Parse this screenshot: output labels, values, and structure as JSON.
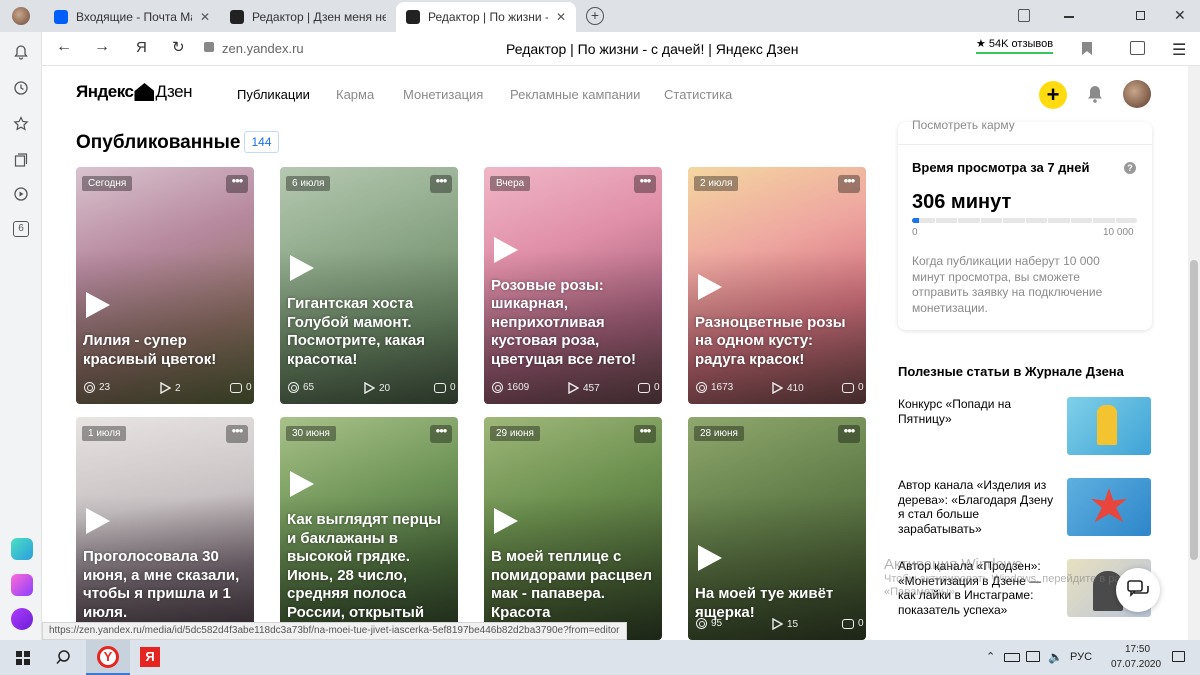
{
  "browser": {
    "tabs": [
      {
        "title": "Входящие - Почта Mail.ru",
        "fav_color": "#005ff9",
        "active": false
      },
      {
        "title": "Редактор | Дзен меня не л",
        "fav_color": "#222222",
        "active": false
      },
      {
        "title": "Редактор | По жизни - с",
        "fav_color": "#222222",
        "active": true
      }
    ],
    "new_tab": "+",
    "address": "zen.yandex.ru",
    "page_title": "Редактор | По жизни - с дачей! | Яндекс Дзен",
    "reviews": "★ 54K отзывов",
    "yandex_letter": "Я",
    "sidebar_badge": "6"
  },
  "header": {
    "logo_text": "Яндекс",
    "logo_text2": "Дзен",
    "nav": [
      "Публикации",
      "Карма",
      "Монетизация",
      "Рекламные кампании",
      "Статистика"
    ],
    "plus": "+"
  },
  "section": {
    "title": "Опубликованные",
    "count": "144"
  },
  "cards": [
    {
      "date": "Сегодня",
      "title": "Лилия - супер красивый цветок!",
      "views": "23",
      "plays": "2",
      "comments": "0",
      "bg": "linear-gradient(160deg,#d9c4cf 0%,#b88aa0 35%,#8d6f63 70%,#5e6b3d 100%)",
      "lines": 2
    },
    {
      "date": "6 июля",
      "title": "Гигантская хоста Голубой мамонт. Посмотрите, какая красотка!",
      "views": "65",
      "plays": "20",
      "comments": "0",
      "bg": "linear-gradient(160deg,#b6c9b2 0%,#8aa585 40%,#6c8a66 70%,#4b5f48 100%)",
      "lines": 4
    },
    {
      "date": "Вчера",
      "title": "Розовые розы: шикарная, неприхотливая кустовая роза, цветущая все лето!",
      "views": "1609",
      "plays": "457",
      "comments": "0",
      "bg": "linear-gradient(160deg,#f0b7c7 0%,#e08fa8 35%,#a5607a 70%,#6b4a50 100%)",
      "lines": 5
    },
    {
      "date": "2 июля",
      "title": "Разноцветные розы на одном кусту: радуга красок!",
      "views": "1673",
      "plays": "410",
      "comments": "0",
      "bg": "linear-gradient(160deg,#f4d7a0 0%,#eea6a0 35%,#d3727e 65%,#7a4d4e 100%)",
      "lines": 3
    },
    {
      "date": "1 июля",
      "title": "Проголосовала 30 июня, а мне сказали, чтобы я пришла и 1 июля.",
      "views": "",
      "plays": "",
      "comments": "",
      "bg": "linear-gradient(170deg,#e8e4e2 0%,#c9c2c4 40%,#7d6f78 70%,#4a3d46 100%)",
      "lines": 4
    },
    {
      "date": "30 июня",
      "title": "Как выглядят перцы и баклажаны в высокой грядке. Июнь, 28 число, средняя полоса России, открытый грунт.",
      "views": "",
      "plays": "",
      "comments": "",
      "bg": "linear-gradient(160deg,#a8c28a 0%,#6f9458 40%,#4b6b3c 70%,#33452b 100%)",
      "lines": 6
    },
    {
      "date": "29 июня",
      "title": "В моей теплице с помидорами расцвел мак - папавера. Красота неимоверная!",
      "views": "",
      "plays": "",
      "comments": "",
      "bg": "linear-gradient(160deg,#9fb87a 0%,#6b8f4e 40%,#4f6a39 70%,#334428 100%)",
      "lines": 4
    },
    {
      "date": "28 июня",
      "title": "На моей туе живёт ящерка!",
      "views": "95",
      "plays": "15",
      "comments": "0",
      "bg": "linear-gradient(160deg,#8fa86e 0%,#66814c 40%,#4d6338 70%,#36442a 100%)",
      "lines": 2
    }
  ],
  "right_panel": {
    "karma_link": "Посмотреть карму",
    "time_title": "Время просмотра за 7 дней",
    "help": "?",
    "minutes": "306 минут",
    "progress_fraction": 0.0306,
    "scale_min": "0",
    "scale_max": "10 000",
    "note": "Когда публикации наберут 10 000 минут просмотра, вы сможете отправить заявку на подключение монетизации."
  },
  "journal": {
    "title": "Полезные статьи в Журнале Дзена",
    "items": [
      {
        "text": "Конкурс «Попади на Пятницу»",
        "img_bg": "linear-gradient(135deg,#7fd0e8,#3fa3d6)"
      },
      {
        "text": "Автор канала «Изделия из дерева»: «Благодаря Дзену я стал больше зарабатывать»",
        "img_bg": "linear-gradient(135deg,#5fb0e0,#2d86c9)"
      },
      {
        "text": "Автор канала «Продзен»: «Монетизация в Дзене — как лайки в Инстаграме: показатель успеха»",
        "img_bg": "linear-gradient(135deg,#e8e0c0,#b8c4d8)"
      }
    ]
  },
  "activation": {
    "line1": "Активация Windows",
    "line2": "Чтобы активировать Windows, перейдите в раздел «Параметры»."
  },
  "status_url": "https://zen.yandex.ru/media/id/5dc582d4f3abe118dc3a73bf/na-moei-tue-jivet-iascerka-5ef8197be446b82d2ba3790e?from=editor",
  "taskbar": {
    "lang": "РУС",
    "time": "17:50",
    "date": "07.07.2020"
  }
}
